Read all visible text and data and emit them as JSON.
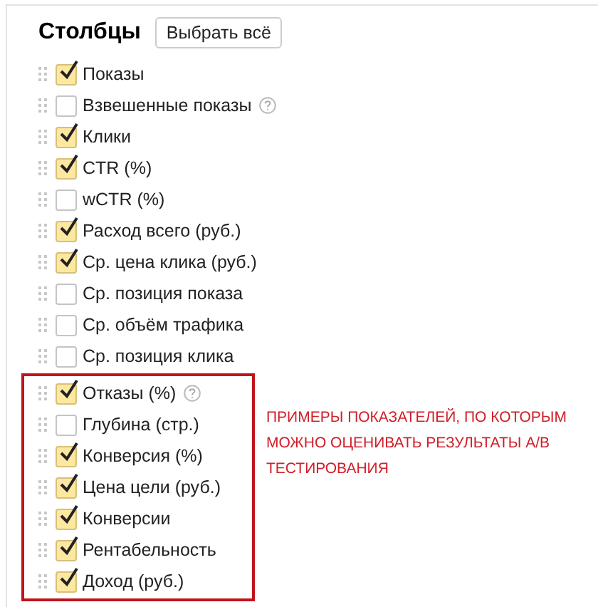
{
  "title": "Столбцы",
  "select_all_button": "Выбрать всё",
  "columns": [
    {
      "label": "Показы",
      "checked": true,
      "help": false
    },
    {
      "label": "Взвешенные показы",
      "checked": false,
      "help": true
    },
    {
      "label": "Клики",
      "checked": true,
      "help": false
    },
    {
      "label": "CTR (%)",
      "checked": true,
      "help": false
    },
    {
      "label": "wCTR (%)",
      "checked": false,
      "help": false
    },
    {
      "label": "Расход всего (руб.)",
      "checked": true,
      "help": false
    },
    {
      "label": "Ср. цена клика (руб.)",
      "checked": true,
      "help": false
    },
    {
      "label": "Ср. позиция показа",
      "checked": false,
      "help": false
    },
    {
      "label": "Ср. объём трафика",
      "checked": false,
      "help": false
    },
    {
      "label": "Ср. позиция клика",
      "checked": false,
      "help": false
    }
  ],
  "highlighted_group": {
    "note": "ПРИМЕРЫ ПОКАЗАТЕЛЕЙ, ПО КОТОРЫМ МОЖНО ОЦЕНИВАТЬ РЕЗУЛЬТАТЫ A/B ТЕСТИРОВАНИЯ",
    "columns": [
      {
        "label": "Отказы (%)",
        "checked": true,
        "help": true
      },
      {
        "label": "Глубина (стр.)",
        "checked": false,
        "help": false
      },
      {
        "label": "Конверсия (%)",
        "checked": true,
        "help": false
      },
      {
        "label": "Цена цели (руб.)",
        "checked": true,
        "help": false
      },
      {
        "label": "Конверсии",
        "checked": true,
        "help": false
      },
      {
        "label": "Рентабельность",
        "checked": true,
        "help": false
      },
      {
        "label": "Доход (руб.)",
        "checked": true,
        "help": false
      }
    ]
  }
}
